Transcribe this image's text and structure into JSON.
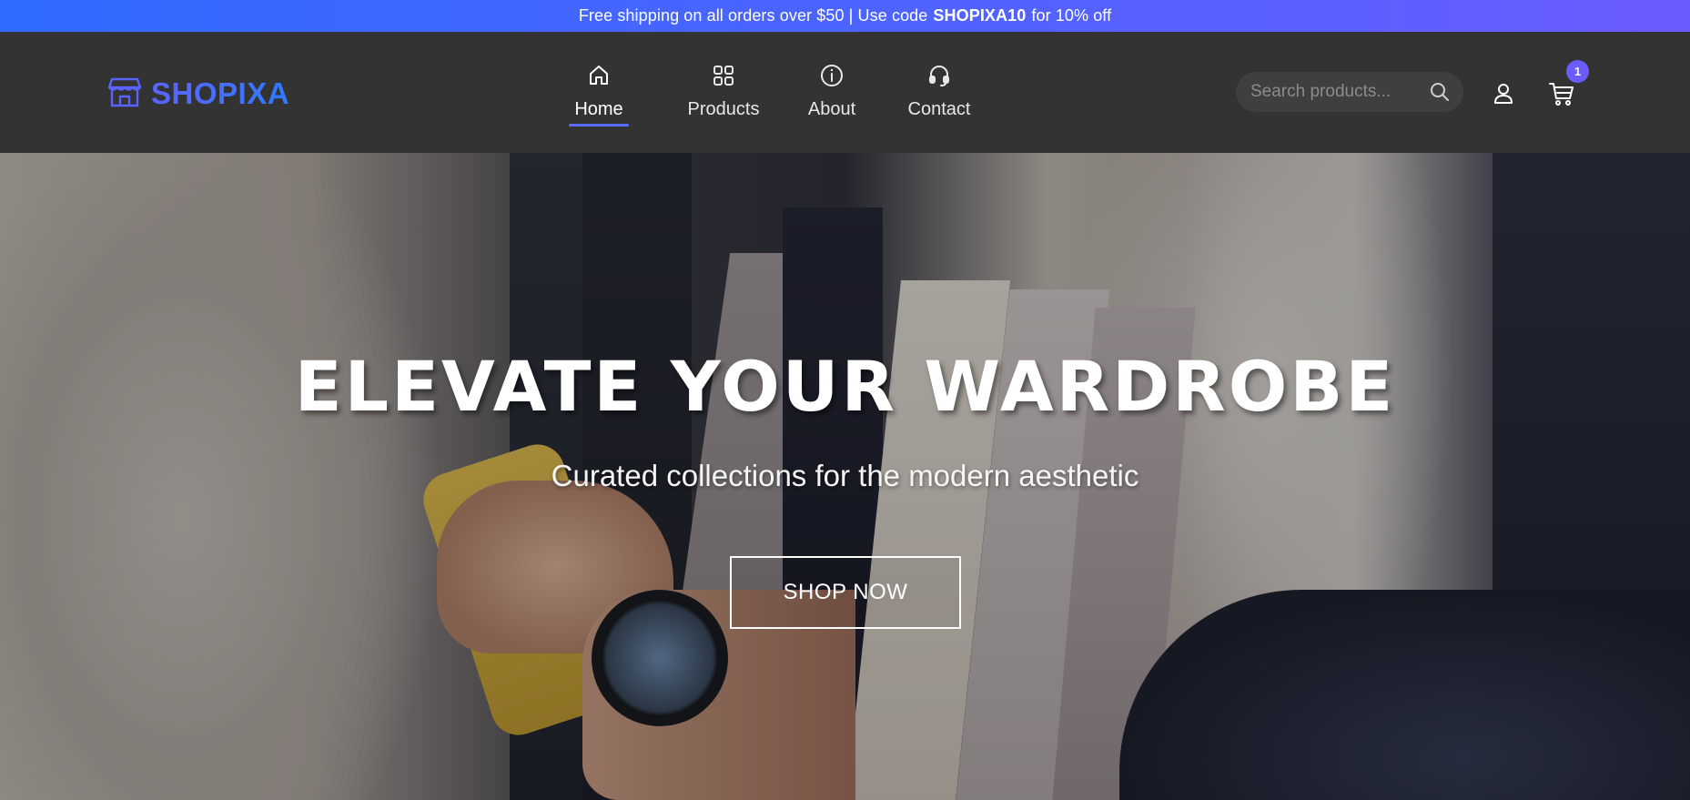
{
  "promo": {
    "text_before": "Free shipping on all orders over $50 | Use code",
    "code": "SHOPIXA10",
    "text_after": "for 10% off"
  },
  "brand": {
    "name": "SHOPIXA",
    "icon": "storefront-icon",
    "colors": {
      "gradient_start": "#5b63ff",
      "gradient_end": "#2e7bff"
    }
  },
  "nav": {
    "items": [
      {
        "label": "Home",
        "icon": "home-icon",
        "active": true
      },
      {
        "label": "Products",
        "icon": "grid-icon",
        "active": false
      },
      {
        "label": "About",
        "icon": "info-icon",
        "active": false
      },
      {
        "label": "Contact",
        "icon": "headset-icon",
        "active": false
      }
    ],
    "active_color": "#5a6dff"
  },
  "search": {
    "placeholder": "Search products...",
    "value": "",
    "icon": "search-icon"
  },
  "account": {
    "icon": "user-icon"
  },
  "cart": {
    "icon": "cart-icon",
    "count": "1",
    "badge_color": "#6a5cff"
  },
  "hero": {
    "title": "ELEVATE YOUR WARDROBE",
    "subtitle": "Curated collections for the modern aesthetic",
    "cta_label": "SHOP NOW"
  },
  "colors": {
    "promo_gradient_start": "#2f6bff",
    "promo_gradient_end": "#6a5cff",
    "header_bg": "#333333"
  }
}
